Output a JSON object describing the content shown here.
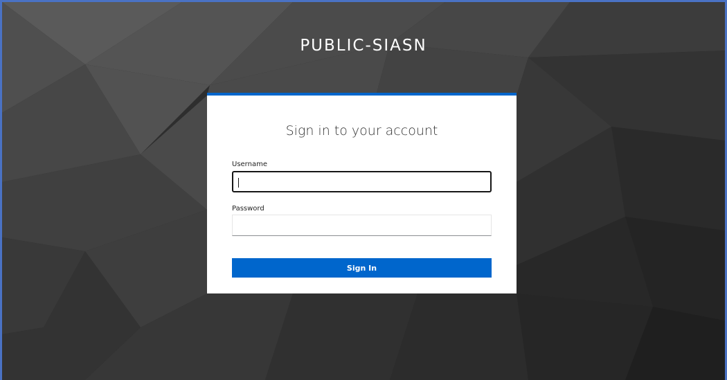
{
  "realm": {
    "title": "PUBLIC-SIASN"
  },
  "login": {
    "heading": "Sign in to your account",
    "username_label": "Username",
    "username_value": "",
    "password_label": "Password",
    "password_value": "",
    "submit_label": "Sign In"
  },
  "colors": {
    "accent": "#0066cc",
    "background": "#2b2b2b",
    "frame": "#4a72c4"
  }
}
